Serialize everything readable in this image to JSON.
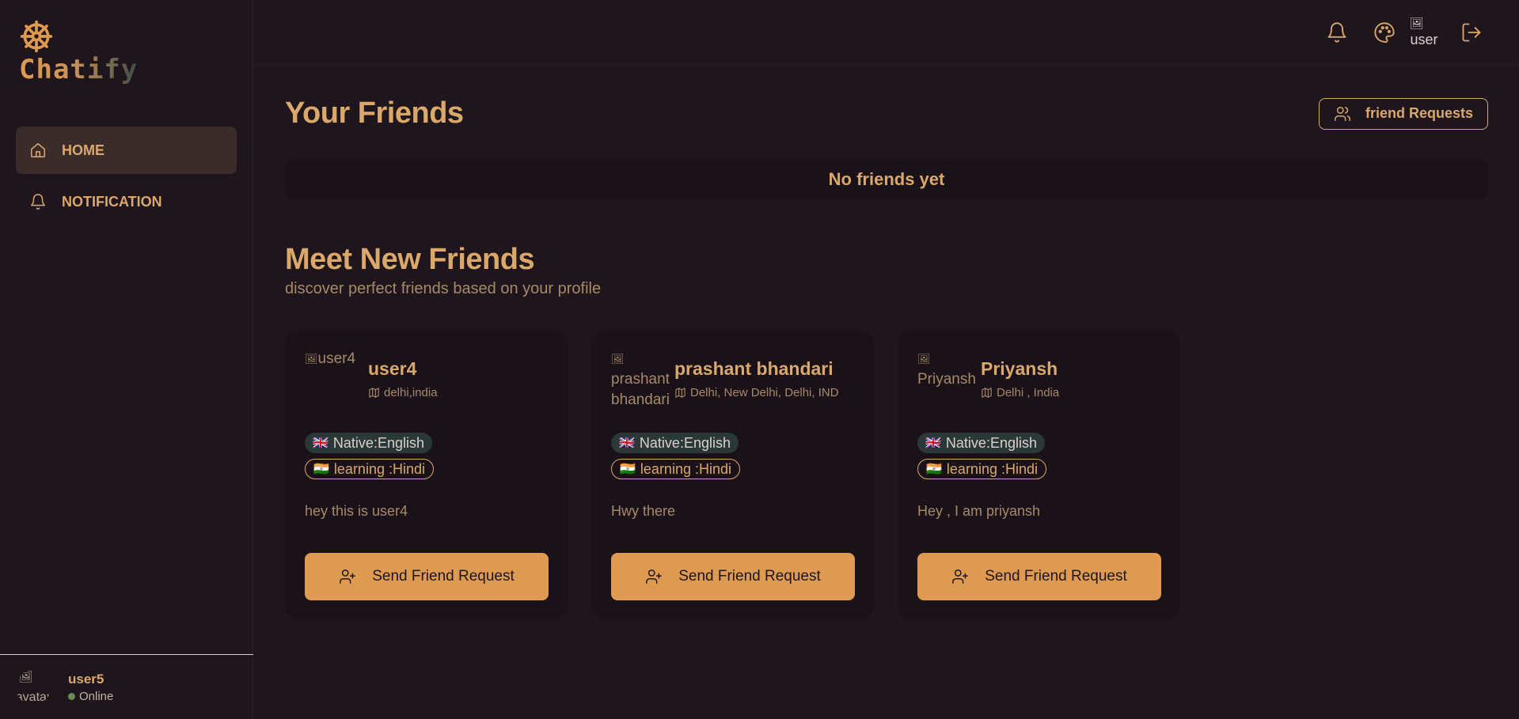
{
  "app": {
    "name": "Chatify",
    "logo_icon": "ship-wheel-icon"
  },
  "sidebar": {
    "items": [
      {
        "label": "HOME",
        "icon": "home-icon",
        "active": true
      },
      {
        "label": "NOTIFICATION",
        "icon": "bell-icon",
        "active": false
      }
    ],
    "profile": {
      "name": "user5",
      "status": "Online",
      "avatar_alt": "avatar"
    }
  },
  "topbar": {
    "icons": [
      "bell-icon",
      "palette-icon",
      "logout-icon"
    ],
    "avatar_alt": "user"
  },
  "friends": {
    "title": "Your Friends",
    "requests_button": "friend Requests",
    "empty_message": "No friends yet"
  },
  "meet": {
    "title": "Meet New Friends",
    "subtitle": "discover perfect friends based on your profile",
    "send_label": "Send Friend Request",
    "cards": [
      {
        "name": "user4",
        "avatar_alt": "user4",
        "location": "delhi,india",
        "native": "Native:English",
        "learning": "learning :Hindi",
        "bio": "hey this is user4"
      },
      {
        "name": "prashant bhandari",
        "avatar_alt": "prashant bhandari",
        "location": "Delhi, New Delhi, Delhi, IND",
        "native": "Native:English",
        "learning": "learning :Hindi",
        "bio": "Hwy there"
      },
      {
        "name": "Priyansh",
        "avatar_alt": "Priyansh",
        "location": "Delhi , India",
        "native": "Native:English",
        "learning": "learning :Hindi",
        "bio": "Hey , I am priyansh"
      }
    ]
  },
  "colors": {
    "background": "#1f161d",
    "accent": "#de9a50",
    "text": "#d9a86a",
    "card": "#1a1218",
    "online": "#6b8a58"
  }
}
